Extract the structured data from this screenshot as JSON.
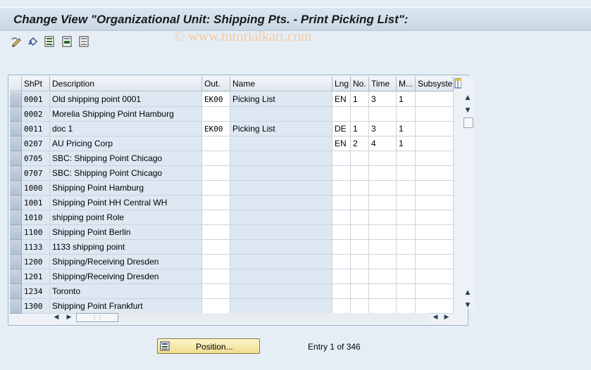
{
  "window": {
    "title": "Change View \"Organizational Unit: Shipping Pts. - Print Picking List\":",
    "watermark": "© www.tutorialkart.com"
  },
  "toolbar": {
    "icons": [
      "edit-pencil-icon",
      "undo-icon",
      "select-all-icon",
      "select-block-icon",
      "deselect-all-icon"
    ]
  },
  "table": {
    "columns": [
      "ShPt",
      "Description",
      "Out.",
      "Name",
      "Lng",
      "No.",
      "Time",
      "M...",
      "Subsystem"
    ],
    "rows": [
      {
        "shpt": "0001",
        "desc": "Old shipping point 0001",
        "out": "EK00",
        "name": "Picking List",
        "lng": "EN",
        "no": "1",
        "time": "3",
        "m": "1",
        "sub": ""
      },
      {
        "shpt": "0002",
        "desc": "Morelia Shipping Point Hamburg",
        "out": "",
        "name": "",
        "lng": "",
        "no": "",
        "time": "",
        "m": "",
        "sub": ""
      },
      {
        "shpt": "0011",
        "desc": "doc 1",
        "out": "EK00",
        "name": "Picking List",
        "lng": "DE",
        "no": "1",
        "time": "3",
        "m": "1",
        "sub": ""
      },
      {
        "shpt": "0207",
        "desc": "AU Pricing Corp",
        "out": "",
        "name": "",
        "lng": "EN",
        "no": "2",
        "time": "4",
        "m": "1",
        "sub": ""
      },
      {
        "shpt": "0705",
        "desc": "SBC: Shipping Point Chicago",
        "out": "",
        "name": "",
        "lng": "",
        "no": "",
        "time": "",
        "m": "",
        "sub": ""
      },
      {
        "shpt": "0707",
        "desc": "SBC: Shipping Point Chicago",
        "out": "",
        "name": "",
        "lng": "",
        "no": "",
        "time": "",
        "m": "",
        "sub": ""
      },
      {
        "shpt": "1000",
        "desc": "Shipping Point Hamburg",
        "out": "",
        "name": "",
        "lng": "",
        "no": "",
        "time": "",
        "m": "",
        "sub": ""
      },
      {
        "shpt": "1001",
        "desc": "Shipping Point HH Central WH",
        "out": "",
        "name": "",
        "lng": "",
        "no": "",
        "time": "",
        "m": "",
        "sub": ""
      },
      {
        "shpt": "1010",
        "desc": "shipping point Role",
        "out": "",
        "name": "",
        "lng": "",
        "no": "",
        "time": "",
        "m": "",
        "sub": ""
      },
      {
        "shpt": "1100",
        "desc": "Shipping Point Berlin",
        "out": "",
        "name": "",
        "lng": "",
        "no": "",
        "time": "",
        "m": "",
        "sub": ""
      },
      {
        "shpt": "1133",
        "desc": "1133 shipping point",
        "out": "",
        "name": "",
        "lng": "",
        "no": "",
        "time": "",
        "m": "",
        "sub": ""
      },
      {
        "shpt": "1200",
        "desc": "Shipping/Receiving Dresden",
        "out": "",
        "name": "",
        "lng": "",
        "no": "",
        "time": "",
        "m": "",
        "sub": ""
      },
      {
        "shpt": "1201",
        "desc": "Shipping/Receiving Dresden",
        "out": "",
        "name": "",
        "lng": "",
        "no": "",
        "time": "",
        "m": "",
        "sub": ""
      },
      {
        "shpt": "1234",
        "desc": "Toronto",
        "out": "",
        "name": "",
        "lng": "",
        "no": "",
        "time": "",
        "m": "",
        "sub": ""
      },
      {
        "shpt": "1300",
        "desc": "Shipping Point Frankfurt",
        "out": "",
        "name": "",
        "lng": "",
        "no": "",
        "time": "",
        "m": "",
        "sub": ""
      }
    ]
  },
  "footer": {
    "position_label": "Position...",
    "entry_text": "Entry 1 of 346"
  }
}
